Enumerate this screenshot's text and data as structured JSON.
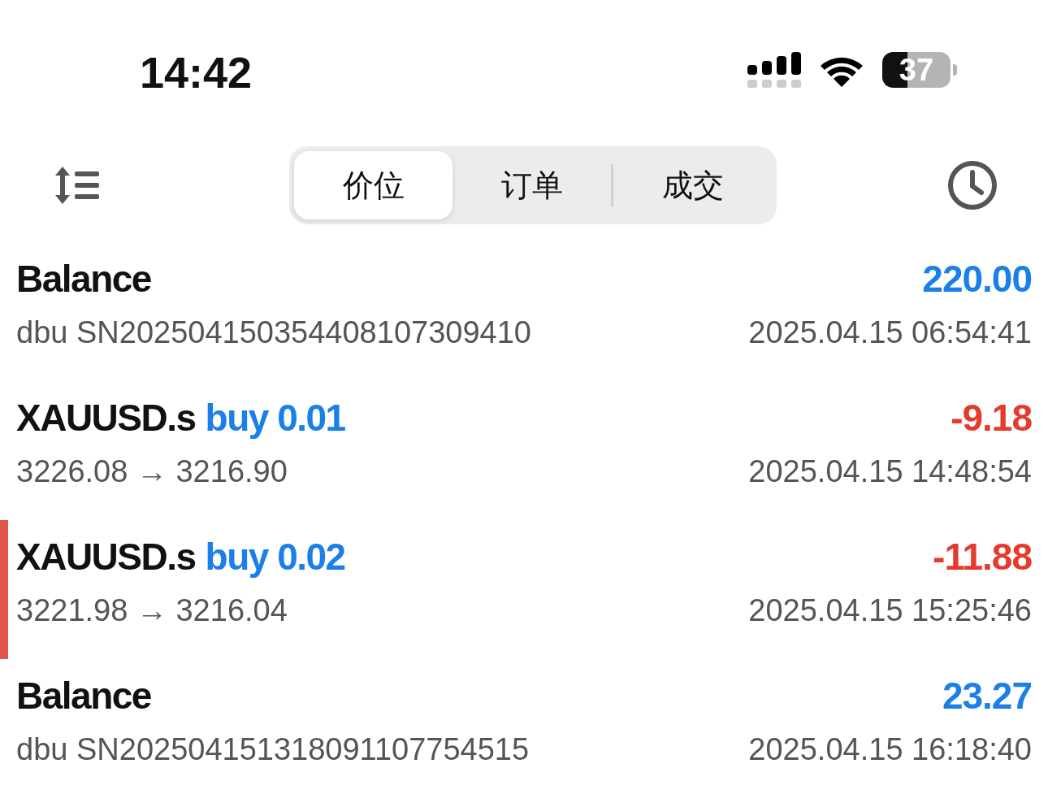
{
  "status_bar": {
    "time": "14:42",
    "battery": "37"
  },
  "tabs": [
    {
      "label": "价位",
      "selected": true
    },
    {
      "label": "订单",
      "selected": false
    },
    {
      "label": "成交",
      "selected": false
    }
  ],
  "rows": [
    {
      "kind": "balance",
      "title": "Balance",
      "amount": "220.00",
      "color": "#1a7fe8",
      "detail": "dbu SN202504150354408107309410",
      "time": "2025.04.15 06:54:41",
      "selected": false
    },
    {
      "kind": "trade",
      "title": "XAUUSD.s",
      "order": "buy 0.01",
      "amount": "-9.18",
      "color": "#e53a2c",
      "detail": "3226.08 → 3216.90",
      "time": "2025.04.15 14:48:54",
      "selected": false
    },
    {
      "kind": "trade",
      "title": "XAUUSD.s",
      "order": "buy 0.02",
      "amount": "-11.88",
      "color": "#e53a2c",
      "detail": "3221.98 → 3216.04",
      "time": "2025.04.15 15:25:46",
      "selected": true
    },
    {
      "kind": "balance",
      "title": "Balance",
      "amount": "23.27",
      "color": "#1a7fe8",
      "detail": "dbu SN202504151318091107754515",
      "time": "2025.04.15 16:18:40",
      "selected": false
    }
  ]
}
